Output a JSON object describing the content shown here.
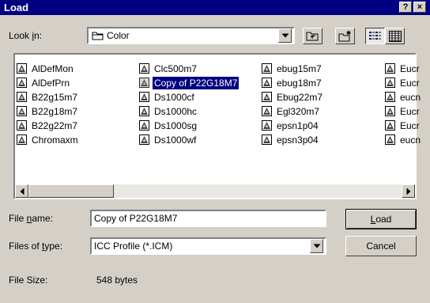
{
  "window": {
    "title": "Load",
    "help_label": "?",
    "close_label": "×"
  },
  "lookin": {
    "label_pre": "Look ",
    "label_u": "i",
    "label_post": "n:",
    "value": "Color"
  },
  "files": [
    {
      "name": "AlDefMon"
    },
    {
      "name": "AlDefPrn"
    },
    {
      "name": "B22g15m7"
    },
    {
      "name": "B22g18m7"
    },
    {
      "name": "B22g22m7"
    },
    {
      "name": "Chromaxm"
    },
    {
      "name": "Clc500m7"
    },
    {
      "name": "Copy of P22G18M7",
      "selected": true
    },
    {
      "name": "Ds1000cf"
    },
    {
      "name": "Ds1000hc"
    },
    {
      "name": "Ds1000sg"
    },
    {
      "name": "Ds1000wf"
    },
    {
      "name": "ebug15m7"
    },
    {
      "name": "ebug18m7"
    },
    {
      "name": "Ebug22m7"
    },
    {
      "name": "Egl320m7"
    },
    {
      "name": "epsn1p04"
    },
    {
      "name": "epsn3p04"
    },
    {
      "name": "Eucr"
    },
    {
      "name": "Eucr"
    },
    {
      "name": "eucn"
    },
    {
      "name": "Eucr"
    },
    {
      "name": "Eucr"
    },
    {
      "name": "eucn"
    }
  ],
  "filename": {
    "label_pre": "File ",
    "label_u": "n",
    "label_post": "ame:",
    "value": "Copy of P22G18M7"
  },
  "filetype": {
    "label_pre": "Files of ",
    "label_u": "t",
    "label_post": "ype:",
    "value": "ICC Profile (*.ICM)"
  },
  "buttons": {
    "load_u": "L",
    "load_rest": "oad",
    "cancel": "Cancel"
  },
  "filesize": {
    "label": "File Size:",
    "value": "548 bytes"
  },
  "colors": {
    "title_bg": "#000080",
    "face": "#d4d0c8",
    "selection": "#000080"
  }
}
